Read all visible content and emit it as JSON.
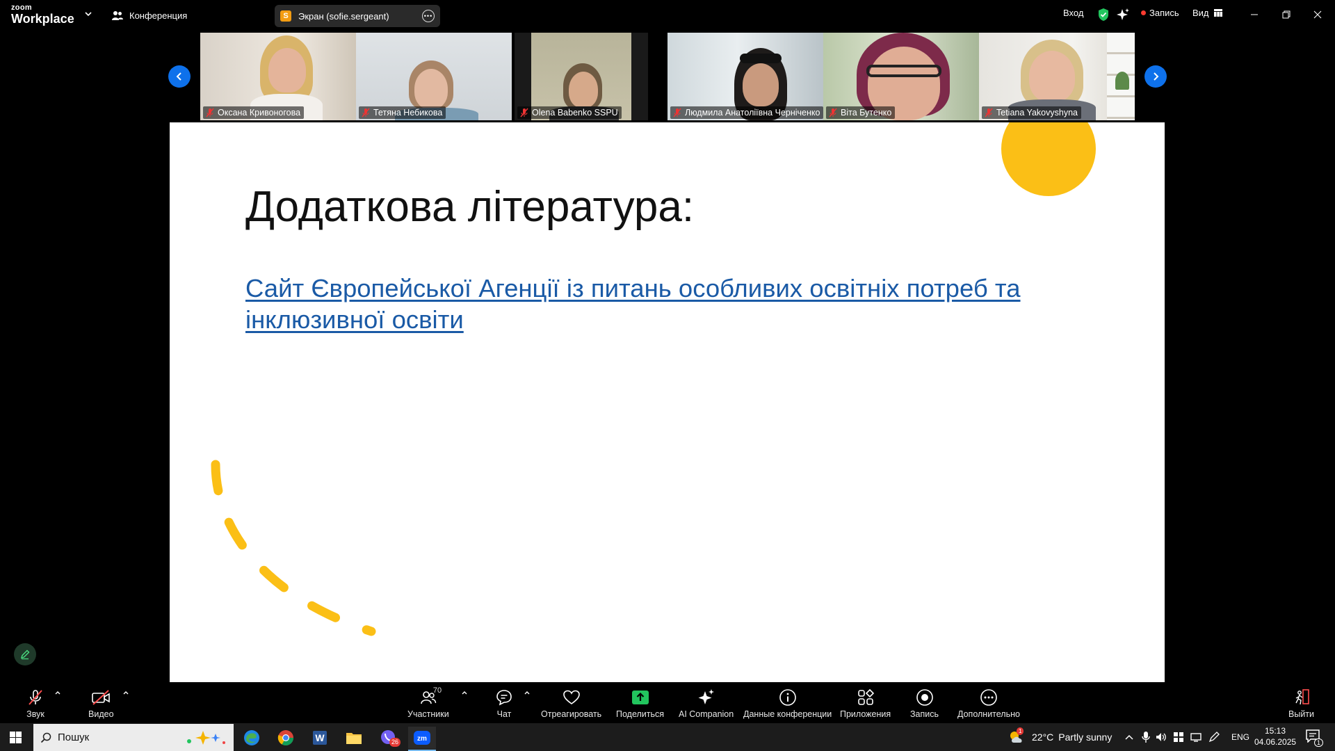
{
  "app": {
    "brand_top": "zoom",
    "brand_bottom": "Workplace"
  },
  "topbar": {
    "meeting_label": "Конференция",
    "share_label": "Экран (sofie.sergeant)",
    "share_initial": "S",
    "signin_label": "Вход",
    "record_label": "Запись",
    "view_label": "Вид"
  },
  "participants_strip": [
    {
      "name": "Оксана Кривоногова",
      "muted": true
    },
    {
      "name": "Тетяна Небикова",
      "muted": true
    },
    {
      "name": "Olena Babenko SSPU",
      "muted": true
    },
    {
      "name": "Людмила Анатоліївна Черніченко",
      "muted": true
    },
    {
      "name": "Віта Бутенко",
      "muted": true
    },
    {
      "name": "Tetiana Yakovyshyna",
      "muted": true
    }
  ],
  "slide": {
    "title": "Додаткова література:",
    "link_text": "Сайт Європейської Агенції із питань особливих освітніх потреб та інклюзивної освіти",
    "accent_color": "#fbbf16",
    "link_color": "#1a5aa6"
  },
  "toolbar": {
    "audio_label": "Звук",
    "video_label": "Видео",
    "participants_label": "Участники",
    "participants_count": "70",
    "chat_label": "Чат",
    "react_label": "Отреагировать",
    "share_label": "Поделиться",
    "ai_label": "AI Companion",
    "info_label": "Данные конференции",
    "apps_label": "Приложения",
    "record_label": "Запись",
    "more_label": "Дополнительно",
    "leave_label": "Выйти"
  },
  "taskbar": {
    "search_placeholder": "Пошук",
    "viber_badge": "26",
    "weather_badge": "1",
    "weather_temp": "22°C",
    "weather_desc": "Partly sunny",
    "lang": "ENG",
    "time": "15:13",
    "date": "04.06.2025",
    "notifications": "1"
  }
}
